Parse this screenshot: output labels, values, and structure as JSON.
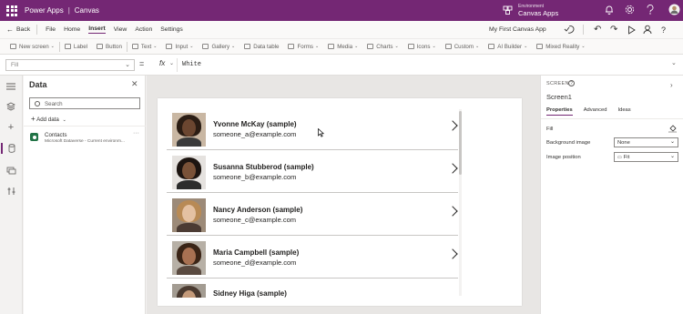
{
  "topbar": {
    "app_name": "Power Apps",
    "separator": "|",
    "mode": "Canvas",
    "environment_label": "Environment",
    "environment_value": "Canvas Apps",
    "bg_color": "#742774"
  },
  "menu": {
    "back": "Back",
    "items": [
      "File",
      "Home",
      "Insert",
      "View",
      "Action",
      "Settings"
    ],
    "active": "Insert",
    "app_title": "My First Canvas App"
  },
  "toolbar": {
    "new_screen": "New screen",
    "label": "Label",
    "button": "Button",
    "text": "Text",
    "input": "Input",
    "gallery": "Gallery",
    "data_table": "Data table",
    "forms": "Forms",
    "media": "Media",
    "charts": "Charts",
    "icons": "Icons",
    "custom": "Custom",
    "ai_builder": "AI Builder",
    "mixed_reality": "Mixed Reality"
  },
  "formula_bar": {
    "property": "Fill",
    "equals": "=",
    "fx": "fx",
    "formula": "White"
  },
  "data_panel": {
    "title": "Data",
    "search_placeholder": "Search",
    "add_data": "Add data",
    "sources": [
      {
        "name": "Contacts",
        "description": "Microsoft Dataverse - Current environm..."
      }
    ]
  },
  "gallery": {
    "items": [
      {
        "name": "Yvonne McKay (sample)",
        "email": "someone_a@example.com"
      },
      {
        "name": "Susanna Stubberod (sample)",
        "email": "someone_b@example.com"
      },
      {
        "name": "Nancy Anderson (sample)",
        "email": "someone_c@example.com"
      },
      {
        "name": "Maria Campbell (sample)",
        "email": "someone_d@example.com"
      },
      {
        "name": "Sidney Higa (sample)",
        "email": ""
      }
    ]
  },
  "properties_panel": {
    "section": "SCREEN",
    "name": "Screen1",
    "tabs": [
      "Properties",
      "Advanced",
      "Ideas"
    ],
    "active_tab": "Properties",
    "fill_label": "Fill",
    "background_image_label": "Background image",
    "background_image_value": "None",
    "image_position_label": "Image position",
    "image_position_value": "Fit"
  }
}
